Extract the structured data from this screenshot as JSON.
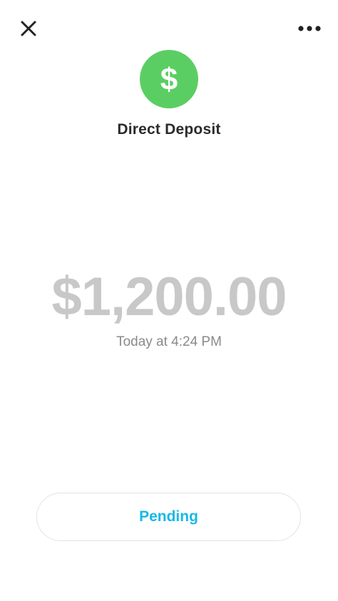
{
  "header": {
    "close_icon": "close-icon",
    "more_icon": "more-horizontal-icon"
  },
  "payment": {
    "avatar_glyph": "$",
    "avatar_color": "#5bce63",
    "title": "Direct Deposit",
    "amount": "$1,200.00",
    "timestamp": "Today at 4:24 PM"
  },
  "status": {
    "label": "Pending",
    "color": "#19b8e6"
  }
}
